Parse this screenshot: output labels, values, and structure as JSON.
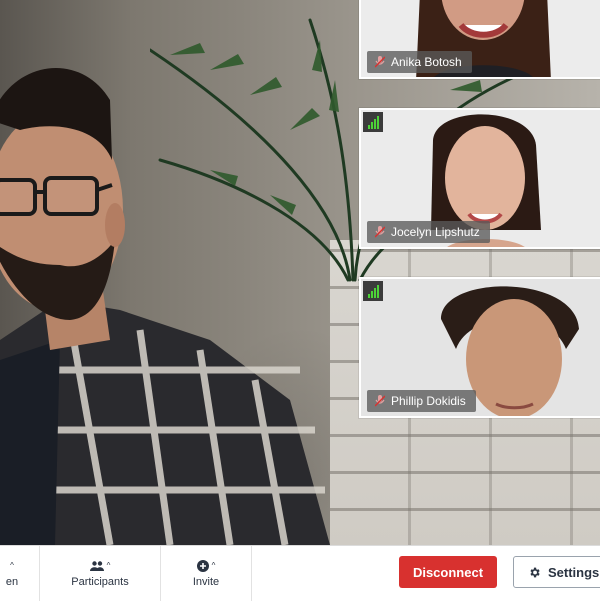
{
  "participants": [
    {
      "name": "Anika Botosh"
    },
    {
      "name": "Jocelyn Lipshutz"
    },
    {
      "name": "Phillip Dokidis"
    }
  ],
  "toolbar": {
    "partial_left_label": "en",
    "participants_label": "Participants",
    "invite_label": "Invite",
    "disconnect_label": "Disconnect",
    "settings_label": "Settings"
  },
  "colors": {
    "disconnect": "#d8312f",
    "signal": "#4cd137",
    "toolbar_text": "#2b3442"
  },
  "icons": {
    "participants": "people-icon",
    "invite": "plus-circle-icon",
    "settings": "gear-icon",
    "mic": "microphone-muted-icon",
    "signal": "signal-bars-icon"
  }
}
